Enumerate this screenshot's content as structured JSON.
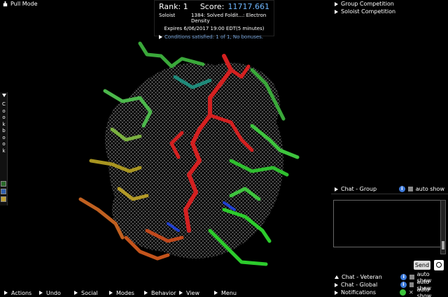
{
  "mode": {
    "label": "Pull Mode",
    "icon": "hand-icon"
  },
  "score_panel": {
    "rank_label": "Rank: 1",
    "score_label": "Score:",
    "score_value": "11717.661",
    "role": "Soloist",
    "puzzle": "1384: Solved Foldit...: Electron Density",
    "expires": "Expires 6/06/2017 19:00 EDT(5 minutes)",
    "conditions": "Conditions satisfied: 1 of 1, No bonuses.",
    "conditions_color": "#7aa8e0",
    "score_color": "#6fb7ff"
  },
  "competitions": [
    "Group Competition",
    "Soloist Competition"
  ],
  "cookbook": {
    "label": "Cookbook",
    "letters": [
      "C",
      "o",
      "o",
      "k",
      "b",
      "o",
      "o",
      "k"
    ]
  },
  "chat_group": {
    "title": "Chat - Group",
    "auto_show": "auto show",
    "send_label": "Send"
  },
  "chat_rows": [
    {
      "name": "Chat - Veteran",
      "status": "auto show"
    },
    {
      "name": "Chat - Global",
      "status": "auto show"
    },
    {
      "name": "Notifications",
      "status": "auto show"
    }
  ],
  "menu": [
    "Actions",
    "Undo",
    "Social",
    "Modes",
    "Behavior",
    "View",
    "Menu"
  ]
}
